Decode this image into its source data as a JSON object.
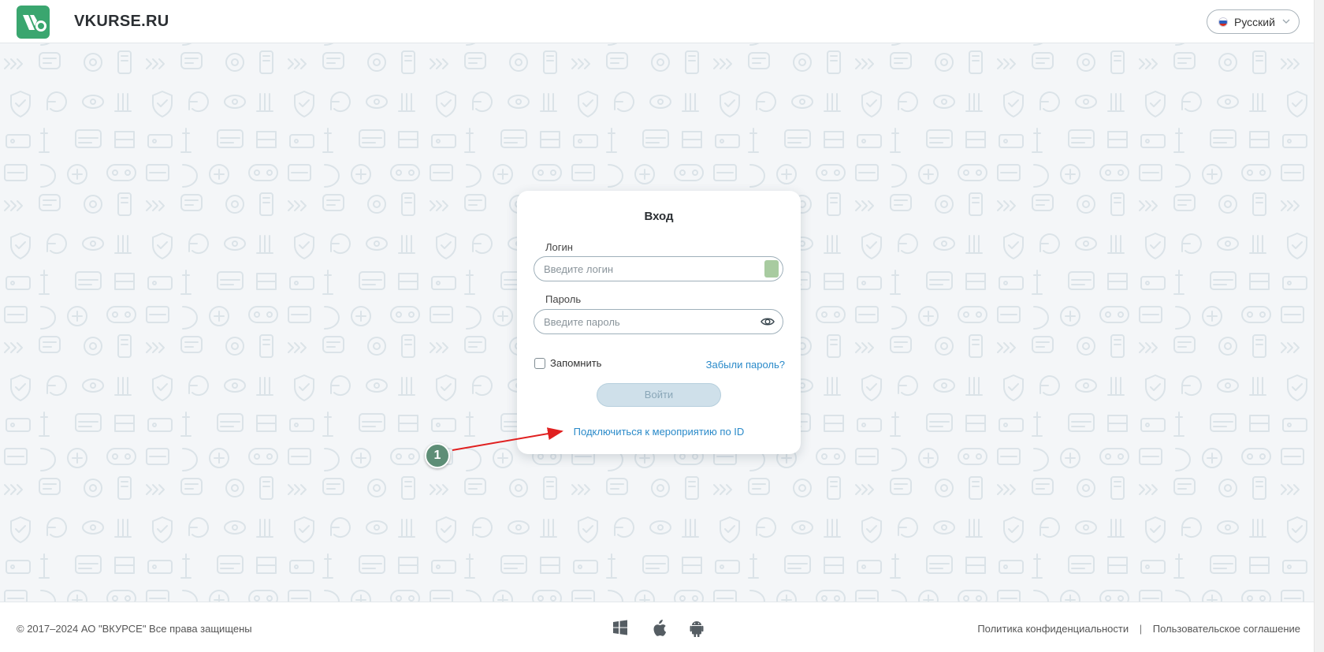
{
  "header": {
    "brand": "VKURSE.RU",
    "language": {
      "selected": "Русский",
      "flag": "ru"
    }
  },
  "login_card": {
    "title": "Вход",
    "login_label": "Логин",
    "login_placeholder": "Введите логин",
    "password_label": "Пароль",
    "password_placeholder": "Введите пароль",
    "remember_label": "Запомнить",
    "remember_checked": false,
    "forgot_link": "Забыли пароль?",
    "submit_label": "Войти",
    "event_link": "Подключиться к мероприятию по ID"
  },
  "annotation": {
    "number": "1"
  },
  "footer": {
    "copyright": "© 2017–2024 АО \"ВКУРСЕ\" Все права защищены",
    "platform_icons": [
      "windows-icon",
      "apple-icon",
      "android-icon"
    ],
    "privacy_link": "Политика конфиденциальности",
    "separator": "|",
    "terms_link": "Пользовательское соглашение"
  },
  "colors": {
    "brand_green": "#3aa66f",
    "link_blue": "#2a8ac9",
    "annotation_red": "#e02020",
    "annotation_badge": "#5e8e76",
    "disabled_button": "#cfe0ea"
  }
}
